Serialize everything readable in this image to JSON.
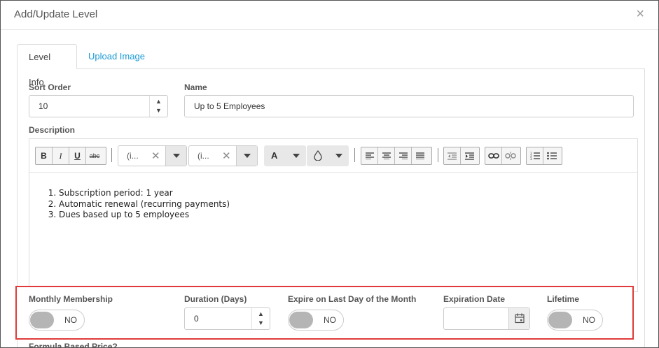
{
  "modal": {
    "title": "Add/Update Level",
    "close_glyph": "×"
  },
  "tabs": [
    {
      "label": "Level Info",
      "active": true
    },
    {
      "label": "Upload Image",
      "active": false
    }
  ],
  "form": {
    "sort_order": {
      "label": "Sort Order",
      "value": "10"
    },
    "name": {
      "label": "Name",
      "value": "Up to 5 Employees"
    },
    "description": {
      "label": "Description"
    }
  },
  "editor": {
    "toolbar": {
      "bold": "B",
      "italic": "I",
      "underline": "U",
      "strikethrough": "abc",
      "font_name": "(i...",
      "font_size": "(i...",
      "font_color": "A",
      "icons": [
        "bold-icon",
        "italic-icon",
        "underline-icon",
        "strikethrough-icon",
        "font-color-icon",
        "background-color-icon",
        "align-left-icon",
        "align-center-icon",
        "align-right-icon",
        "justify-icon",
        "outdent-icon",
        "indent-icon",
        "link-icon",
        "unlink-icon",
        "ordered-list-icon",
        "unordered-list-icon"
      ]
    },
    "content_items": [
      "Subscription period: 1 year",
      "Automatic renewal (recurring payments)",
      "Dues based up to 5 employees"
    ]
  },
  "highlighted_row": {
    "monthly_membership": {
      "label": "Monthly Membership",
      "toggle": "NO"
    },
    "duration": {
      "label": "Duration (Days)",
      "value": "0"
    },
    "expire_last_day": {
      "label": "Expire on Last Day of the Month",
      "toggle": "NO"
    },
    "expiration_date": {
      "label": "Expiration Date",
      "value": ""
    },
    "lifetime": {
      "label": "Lifetime",
      "toggle": "NO"
    }
  },
  "next_field_label": "Formula Based Price?",
  "colors": {
    "highlight_border": "#e03a3a",
    "link": "#1a9ad6",
    "toggle_knob": "#b5b5b5"
  }
}
